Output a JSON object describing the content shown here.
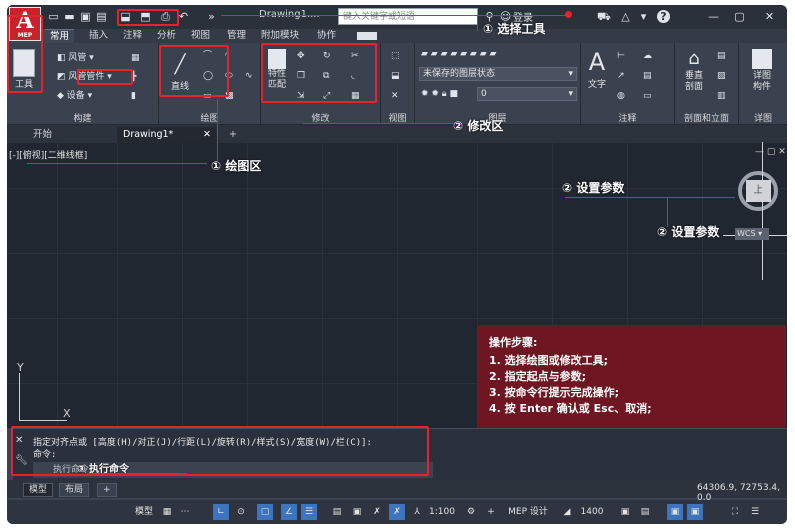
{
  "app": {
    "logo_text": "A",
    "logo_sub": "MEP",
    "document_title": "Drawing1....",
    "search_placeholder": "键入关键字或短语",
    "login_label": "登录",
    "help_label": "?"
  },
  "ribbon_tabs": [
    "常用",
    "插入",
    "注释",
    "分析",
    "视图",
    "管理",
    "附加模块",
    "协作"
  ],
  "ribbon": {
    "panel_build": {
      "title": "构建",
      "tool_big": "工具",
      "duct": "风管",
      "duct_fitting": "风管管件",
      "equipment": "设备"
    },
    "panel_draw": {
      "title": "绘图",
      "line_label": "直线"
    },
    "panel_modify": {
      "title": "修改",
      "match_label": "特性\n匹配"
    },
    "panel_view": {
      "title": "视图"
    },
    "panel_layers": {
      "title": "图层",
      "layer_state": "未保存的图层状态",
      "layer_current": "0"
    },
    "panel_annotation": {
      "title": "注释",
      "text_label": "文字"
    },
    "panel_section": {
      "title": "剖面和立面",
      "vertical_section": "垂直\n剖面"
    },
    "panel_detail": {
      "title": "详图",
      "detail_component": "详图\n构件"
    }
  },
  "doc_tabs": [
    "开始",
    "Drawing1*",
    "+"
  ],
  "viewport_label": "[-][俯视][二维线框]",
  "annotations": {
    "select_tool": "① 选择工具",
    "modify_area": "② 修改区",
    "draw_area": "① 绘图区",
    "set_params_1": "② 设置参数",
    "set_params_2": "② 设置参数",
    "exec_command": "③ 执行命令"
  },
  "steps_box": {
    "title": "操作步骤:",
    "steps": [
      "1. 选择绘图或修改工具;",
      "2. 指定起点与参数;",
      "3. 按命令行提示完成操作;",
      "4. 按 Enter 确认或 Esc、取消;"
    ]
  },
  "viewcube": {
    "face": "上",
    "wcs": "WCS"
  },
  "command_line": {
    "line1": "指定对齐点或 [高度(H)/对正(J)/行距(L)/旋转(R)/样式(S)/宽度(W)/栏(C)]:",
    "line2": "命令:",
    "input_placeholder": "执行命令"
  },
  "layout_tabs": [
    "模型",
    "布局",
    "+"
  ],
  "coordinates": "64306.9, 72753.4, 0.0",
  "status_bar": {
    "model": "模型",
    "scale": "1:100",
    "mep_design": "MEP 设计",
    "number": "1400"
  },
  "ucs": {
    "x": "X",
    "y": "Y"
  }
}
